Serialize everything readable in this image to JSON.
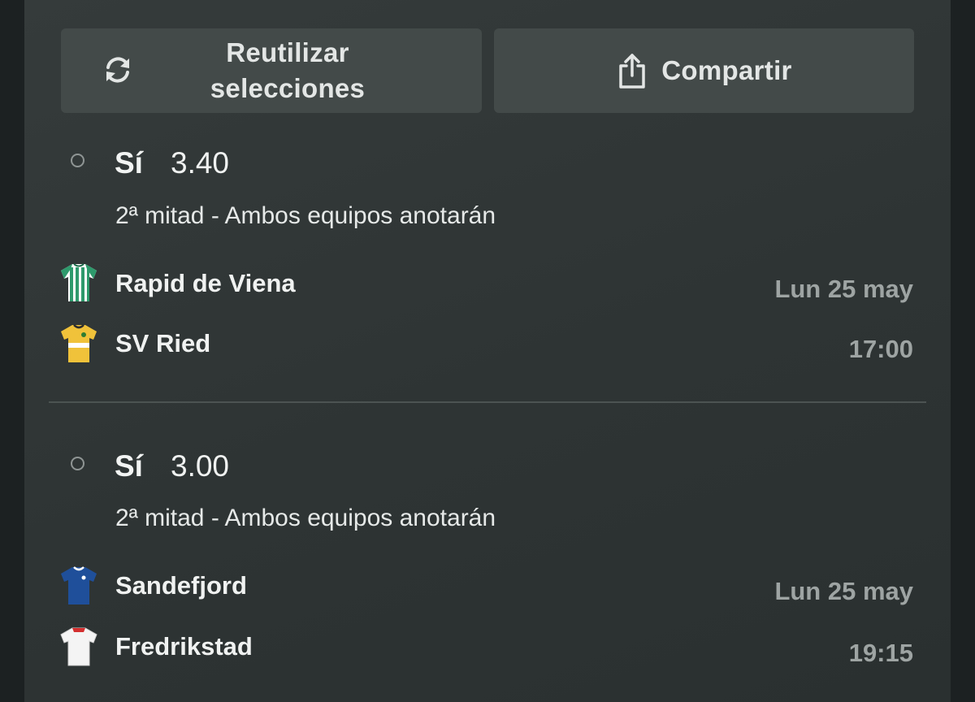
{
  "actions": {
    "reuse_label": "Reutilizar selecciones",
    "reuse_icon": "refresh-icon",
    "share_label": "Compartir",
    "share_icon": "share-icon"
  },
  "selections": [
    {
      "pick": "Sí",
      "odds": "3.40",
      "market": "2ª mitad - Ambos equipos anotarán",
      "home_team": "Rapid de Viena",
      "away_team": "SV Ried",
      "date": "Lun 25 may",
      "time": "17:00"
    },
    {
      "pick": "Sí",
      "odds": "3.00",
      "market": "2ª mitad - Ambos equipos anotarán",
      "home_team": "Sandefjord",
      "away_team": "Fredrikstad",
      "date": "Lun 25 may",
      "time": "19:15"
    }
  ],
  "colors": {
    "panel": "#313737",
    "button": "#434a49",
    "text_primary": "#f0f2f1",
    "text_secondary": "#9ea4a3",
    "rapid_shirt": "#2e9a6c",
    "ried_shirt": "#f0c23a",
    "sandefjord_shirt": "#1f4f9a",
    "fredrikstad_shirt": "#f4f4f4"
  }
}
